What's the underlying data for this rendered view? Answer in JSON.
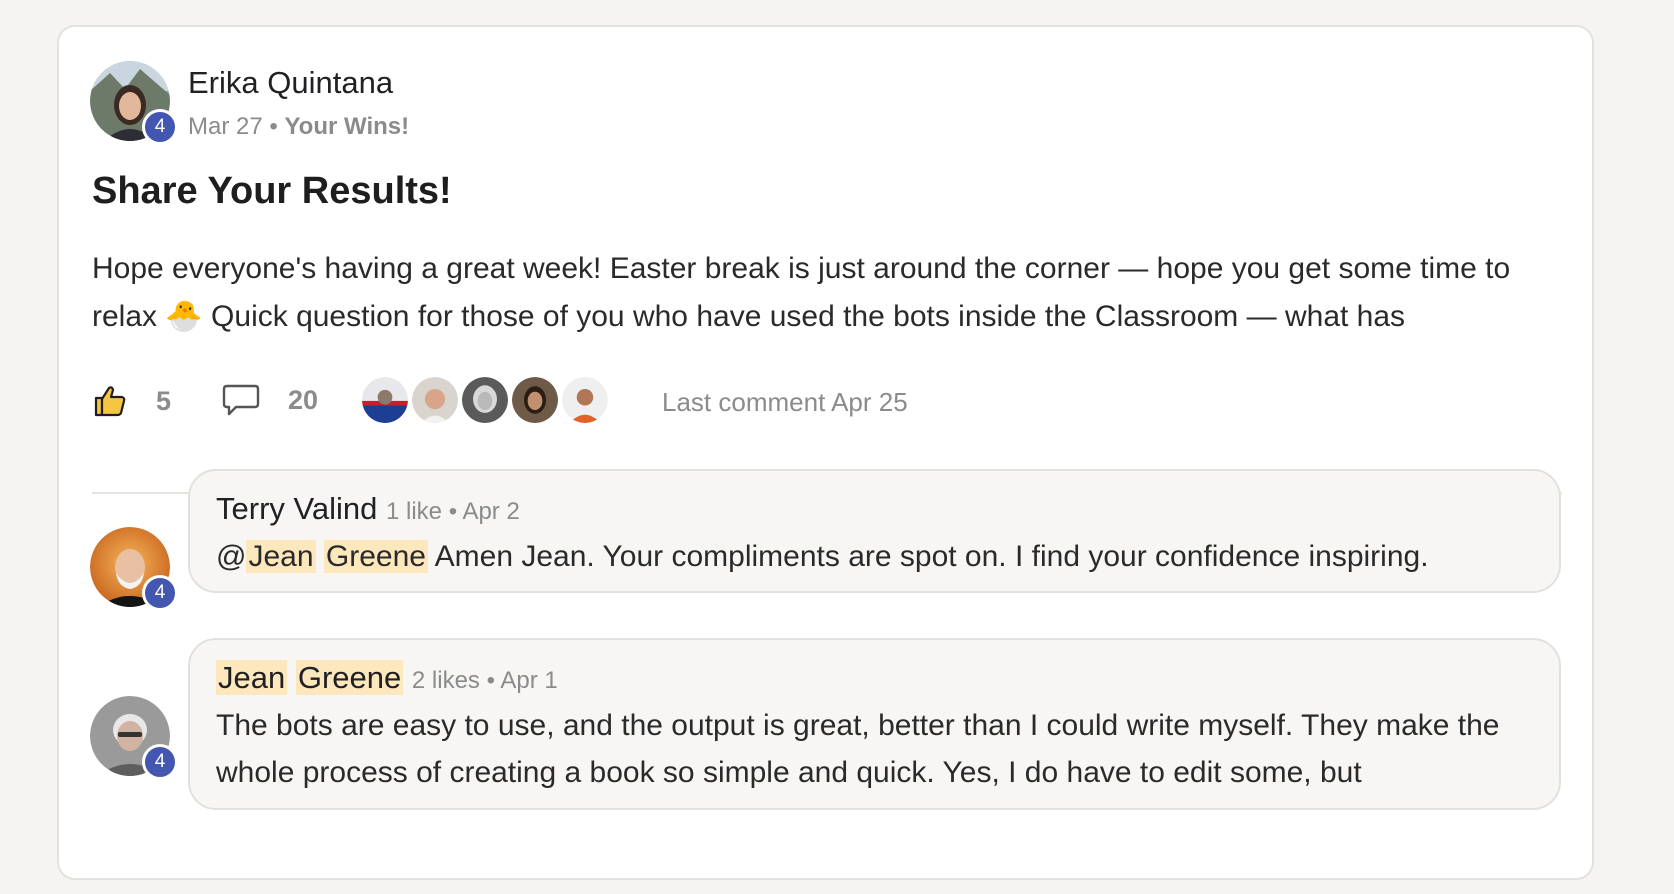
{
  "post": {
    "author": "Erika Quintana",
    "date": "Mar 27",
    "separator": "•",
    "category": "Your Wins!",
    "level": "4",
    "title": "Share Your Results!",
    "body": "Hope everyone's having a great week! Easter break is just around the corner — hope you get some time to relax 🐣 Quick question for those of you who have used the bots inside the Classroom — what has",
    "likes": "5",
    "comments": "20",
    "last_comment": "Last comment Apr 25",
    "icons": {
      "like": "thumbs-up-icon",
      "comment": "speech-bubble-icon"
    }
  },
  "comments": [
    {
      "author": "Terry Valind",
      "meta": "1 like • Apr 2",
      "level": "4",
      "mention_prefix": "@",
      "mention_first": "Jean",
      "mention_last": "Greene",
      "text": " Amen Jean. Your compliments are spot on. I find your confidence inspiring."
    },
    {
      "author_first": "Jean",
      "author_last": "Greene",
      "meta": "2 likes • Apr 1",
      "level": "4",
      "text": "The bots are easy to use, and the output is great, better than I could write myself. They make the whole process of creating a book so simple and quick. Yes, I do have to edit some, but"
    }
  ],
  "colors": {
    "level_badge": "#4357b1",
    "mention_highlight": "#fde8bd",
    "muted_text": "#8b8b8b"
  }
}
